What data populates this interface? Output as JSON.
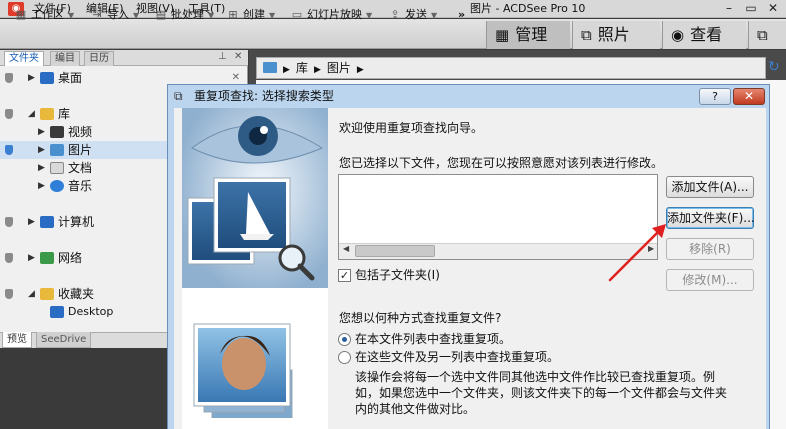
{
  "menubar": {
    "app_icon": "acdsee-camera-icon",
    "items": [
      "文件(F)",
      "编辑(E)",
      "视图(V)",
      "工具(T)"
    ],
    "title": "图片 - ACDSee Pro 10",
    "window_buttons": [
      "minimize",
      "maximize",
      "close"
    ]
  },
  "toolbar": {
    "items": [
      {
        "label": "工作区",
        "icon": "workspace-icon"
      },
      {
        "label": "导入",
        "icon": "import-icon"
      },
      {
        "label": "批处理",
        "icon": "batch-icon"
      },
      {
        "label": "创建",
        "icon": "create-icon"
      },
      {
        "label": "幻灯片放映",
        "icon": "slideshow-icon"
      },
      {
        "label": "发送",
        "icon": "send-icon"
      }
    ],
    "overflow": "»",
    "modes": [
      {
        "label": "管理",
        "icon": "grid-icon"
      },
      {
        "label": "照片",
        "icon": "photo-tag-icon"
      },
      {
        "label": "查看",
        "icon": "eye-icon"
      },
      {
        "label": "",
        "icon": "edit-mode-icon"
      }
    ]
  },
  "left_panel": {
    "tabs": [
      "文件夹",
      "编目",
      "日历"
    ],
    "tree": [
      {
        "label": "桌面",
        "icon": "desktop-icon"
      },
      {
        "label": "库",
        "icon": "library-icon"
      },
      {
        "label": "视频",
        "icon": "video-icon"
      },
      {
        "label": "图片",
        "icon": "pictures-icon",
        "selected": true
      },
      {
        "label": "文档",
        "icon": "documents-icon"
      },
      {
        "label": "音乐",
        "icon": "music-icon"
      },
      {
        "label": "计算机",
        "icon": "computer-icon"
      },
      {
        "label": "网络",
        "icon": "network-icon"
      },
      {
        "label": "收藏夹",
        "icon": "favorites-icon"
      },
      {
        "label": "Desktop",
        "icon": "desktop-icon"
      }
    ],
    "bottom_tabs": [
      "预览",
      "SeeDrive"
    ]
  },
  "breadcrumb": {
    "items": [
      "库",
      "图片"
    ]
  },
  "dialog": {
    "title": "重复项查找: 选择搜索类型",
    "help_label": "?",
    "close_label": "✕",
    "welcome": "欢迎使用重复项查找向导。",
    "selected_files_prompt": "您已选择以下文件，您现在可以按照意愿对该列表进行修改。",
    "buttons": {
      "add_file": "添加文件(A)...",
      "add_folder": "添加文件夹(F)...",
      "remove": "移除(R)",
      "modify": "修改(M)..."
    },
    "include_subfolders": {
      "label": "包括子文件夹(I)",
      "checked": true
    },
    "how_question": "您想以何种方式查找重复文件?",
    "options": [
      {
        "label": "在本文件列表中查找重复项。",
        "selected": true
      },
      {
        "label": "在这些文件及另一列表中查找重复项。",
        "selected": false
      }
    ],
    "description": [
      "该操作会将每一个选中文件同其他选中文件作比较已查找重复项。例",
      "如，如果您选中一个文件夹，则该文件夹下的每一个文件都会与文件夹",
      "内的其他文件做对比。"
    ]
  }
}
